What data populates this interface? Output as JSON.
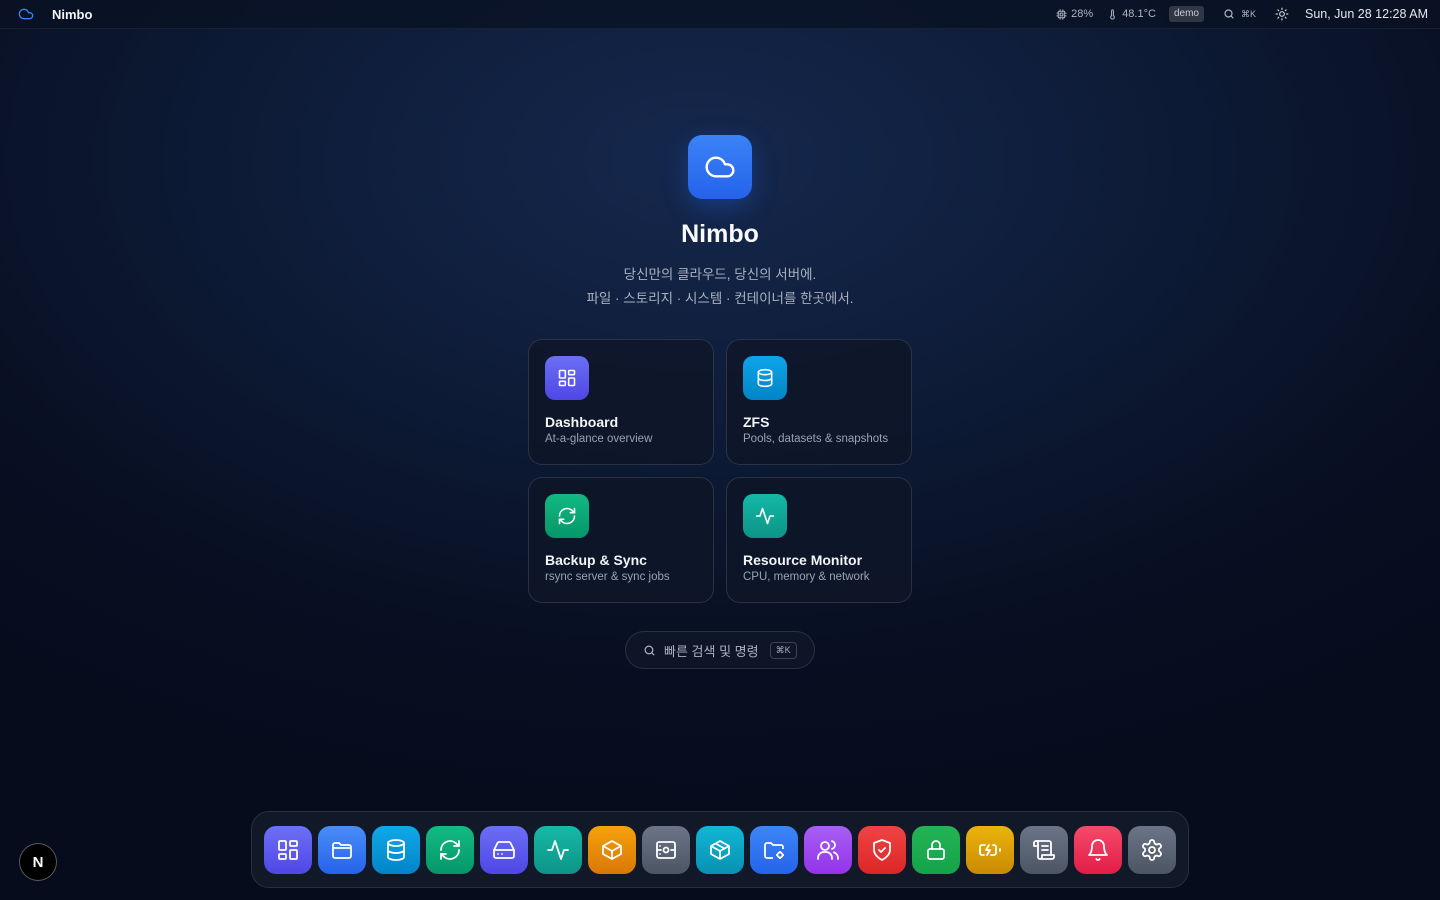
{
  "topbar": {
    "app_name": "Nimbo",
    "logo_icon": "cloud-icon",
    "cpu_usage": "28%",
    "temperature": "48.1°C",
    "mode_badge": "demo",
    "search_shortcut": "⌘K",
    "theme_icon": "sun-icon",
    "clock": "Sun, Jun 28 12:28 AM"
  },
  "hero": {
    "icon": "cloud-icon",
    "title": "Nimbo",
    "subtitle_line1": "당신만의 클라우드, 당신의 서버에.",
    "subtitle_line2": "파일 · 스토리지 · 시스템 · 컨테이너를 한곳에서."
  },
  "cards": [
    {
      "title": "Dashboard",
      "description": "At-a-glance overview",
      "icon": "dashboard-icon",
      "color": "#6366f1"
    },
    {
      "title": "ZFS",
      "description": "Pools, datasets & snapshots",
      "icon": "database-icon",
      "color": "#0ea5e9"
    },
    {
      "title": "Backup & Sync",
      "description": "rsync server & sync jobs",
      "icon": "refresh-icon",
      "color": "#10b981"
    },
    {
      "title": "Resource Monitor",
      "description": "CPU, memory & network",
      "icon": "activity-icon",
      "color": "#14b8a6"
    }
  ],
  "quick_search": {
    "placeholder": "빠른 검색 및 명령",
    "shortcut": "⌘K"
  },
  "dock": [
    {
      "name": "dashboard",
      "icon": "dashboard-icon",
      "color": "#6366f1"
    },
    {
      "name": "files",
      "icon": "folder-icon",
      "color": "#3b82f6"
    },
    {
      "name": "zfs",
      "icon": "database-icon",
      "color": "#0ea5e9"
    },
    {
      "name": "backup-sync",
      "icon": "refresh-icon",
      "color": "#10b981"
    },
    {
      "name": "drives",
      "icon": "hard-drive-icon",
      "color": "#6366f1"
    },
    {
      "name": "resource-monitor",
      "icon": "activity-icon",
      "color": "#14b8a6"
    },
    {
      "name": "containers",
      "icon": "package-icon",
      "color": "#f59e0b"
    },
    {
      "name": "services",
      "icon": "server-cog-icon",
      "color": "#64748b"
    },
    {
      "name": "virtual-machines",
      "icon": "box-icon",
      "color": "#06b6d4"
    },
    {
      "name": "shares",
      "icon": "folder-cog-icon",
      "color": "#3b82f6"
    },
    {
      "name": "users",
      "icon": "users-icon",
      "color": "#a855f7"
    },
    {
      "name": "security",
      "icon": "shield-check-icon",
      "color": "#ef4444"
    },
    {
      "name": "vpn",
      "icon": "lock-icon",
      "color": "#16a34a"
    },
    {
      "name": "power",
      "icon": "battery-charging-icon",
      "color": "#eab308"
    },
    {
      "name": "logs",
      "icon": "scroll-icon",
      "color": "#64748b"
    },
    {
      "name": "notifications",
      "icon": "bell-icon",
      "color": "#f43f5e"
    },
    {
      "name": "settings",
      "icon": "gear-icon",
      "color": "#64748b"
    }
  ],
  "corner_badge": "N"
}
